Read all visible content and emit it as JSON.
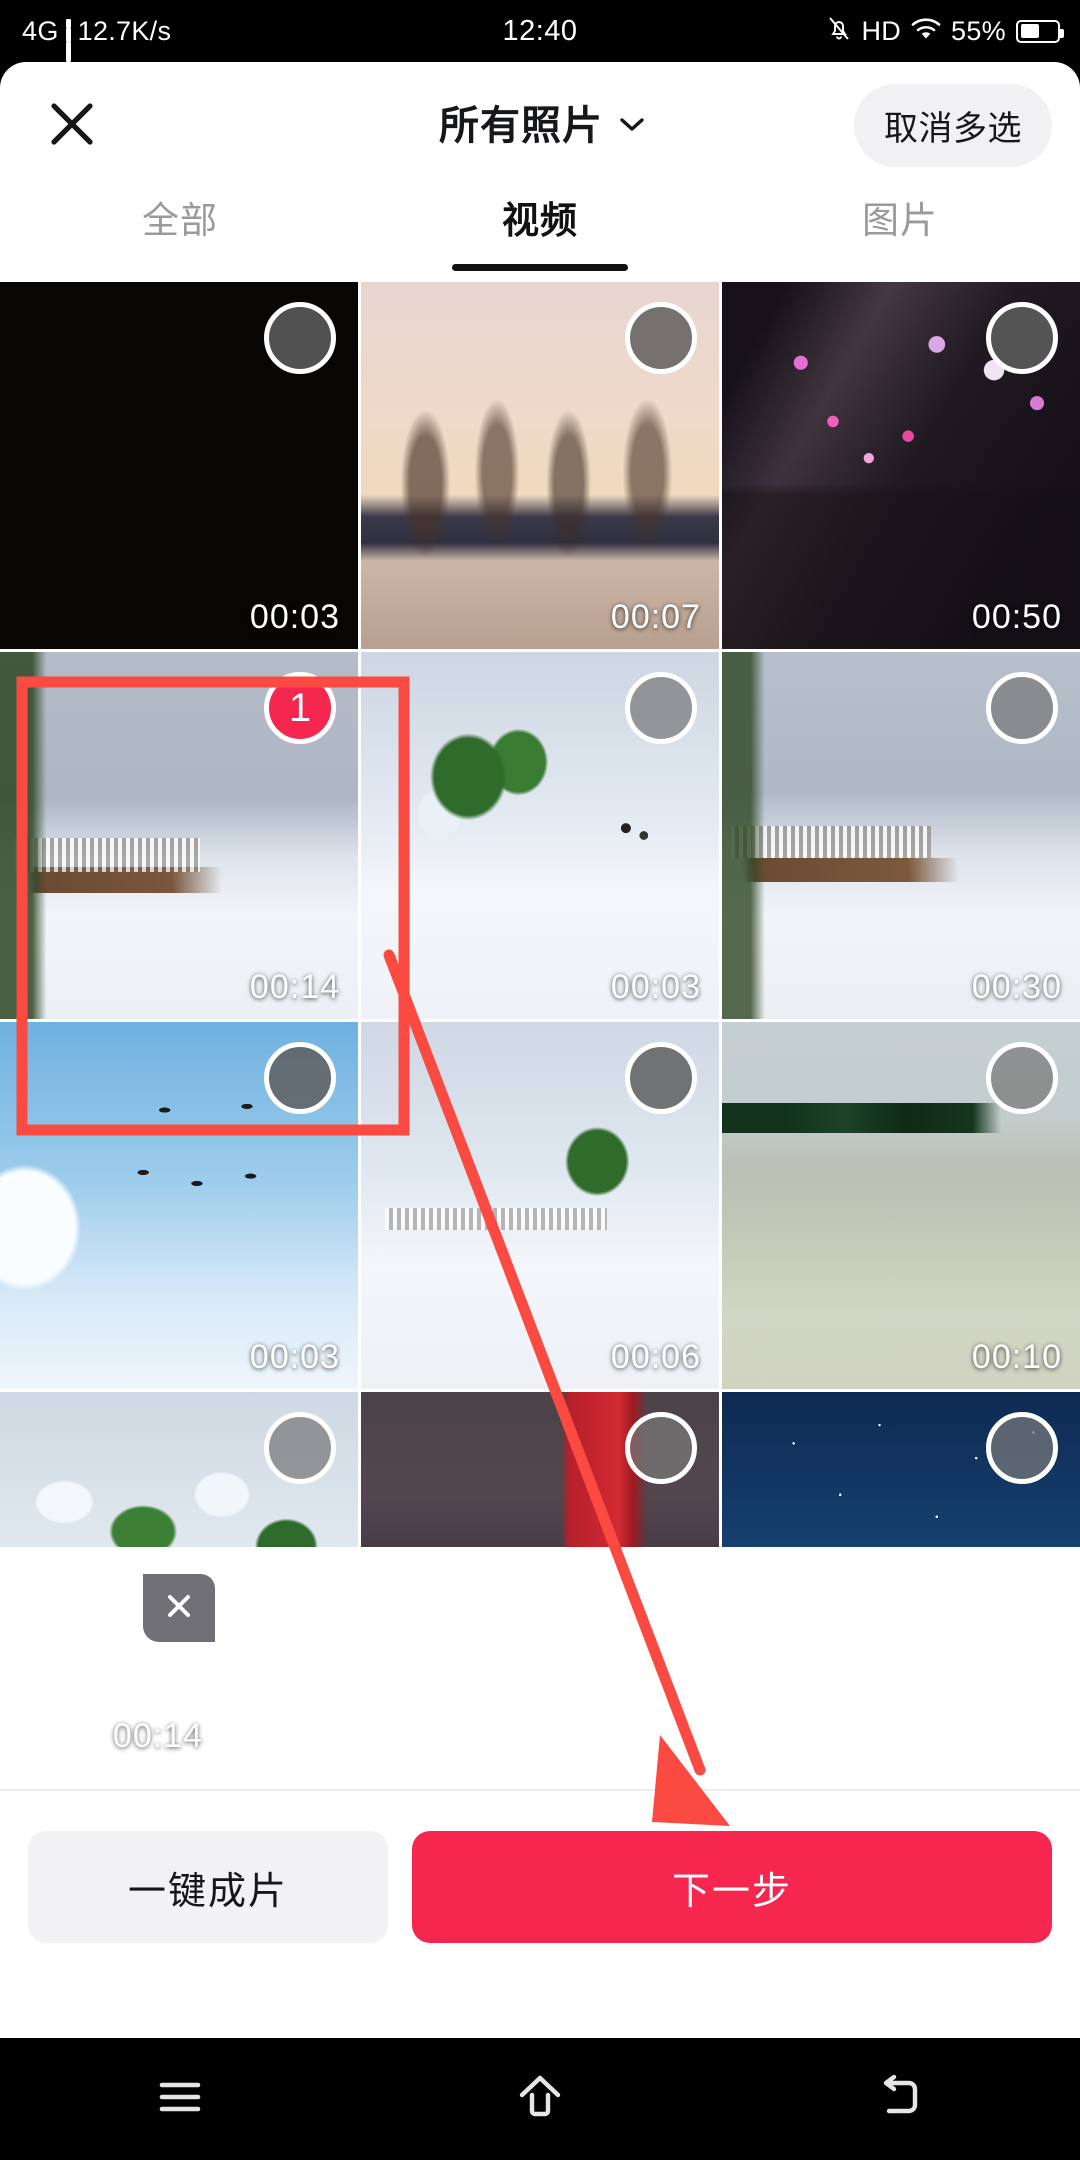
{
  "status_bar": {
    "network_type": "4G",
    "signal_icon": "signal-bars-icon",
    "data_rate": "12.7K/s",
    "time": "12:40",
    "mute_icon": "bell-mute-icon",
    "hd_label": "HD",
    "wifi_icon": "wifi-icon",
    "battery_percent": "55%",
    "battery_icon": "battery-icon"
  },
  "header": {
    "close_icon": "close-icon",
    "album_title": "所有照片",
    "album_chevron_icon": "chevron-down-icon",
    "multi_select_label": "取消多选"
  },
  "tabs": [
    {
      "label": "全部",
      "active": false
    },
    {
      "label": "视频",
      "active": true
    },
    {
      "label": "图片",
      "active": false
    }
  ],
  "grid": {
    "items": [
      {
        "duration": "00:03",
        "selected": false,
        "art": "t-black",
        "circle": "dark"
      },
      {
        "duration": "00:07",
        "selected": false,
        "art": "t-trees-pink",
        "circle": "dark"
      },
      {
        "duration": "00:50",
        "selected": false,
        "art": "t-blossom",
        "circle": "dark"
      },
      {
        "duration": "00:14",
        "selected": true,
        "art": "t-snow-fence",
        "circle": "selected",
        "badge": "1"
      },
      {
        "duration": "00:03",
        "selected": false,
        "art": "t-snow-tree",
        "circle": "light"
      },
      {
        "duration": "00:30",
        "selected": false,
        "art": "t-snow-fence2",
        "circle": "light"
      },
      {
        "duration": "00:03",
        "selected": false,
        "art": "t-birds",
        "circle": "dark"
      },
      {
        "duration": "00:06",
        "selected": false,
        "art": "t-snow-field",
        "circle": "dark"
      },
      {
        "duration": "00:10",
        "selected": false,
        "art": "t-lake",
        "circle": "light"
      },
      {
        "duration": "",
        "selected": false,
        "art": "t-snow-green",
        "circle": "light"
      },
      {
        "duration": "",
        "selected": false,
        "art": "t-festival",
        "circle": "light"
      },
      {
        "duration": "",
        "selected": false,
        "art": "t-night-tree",
        "circle": "light"
      }
    ]
  },
  "tray": {
    "items": [
      {
        "duration": "00:14",
        "remove_icon": "close-icon",
        "art": "t-snow-fence"
      }
    ]
  },
  "actions": {
    "secondary_label": "一键成片",
    "primary_label": "下一步"
  },
  "nav_bar": {
    "recents_icon": "recents-icon",
    "home_icon": "home-icon",
    "back_icon": "back-icon"
  },
  "annotation": {
    "box_color": "#fa4a42",
    "arrow_color": "#fa4a42"
  },
  "colors": {
    "accent_red": "#f5274e",
    "annotation_red": "#fa4a42",
    "tab_active": "#111111",
    "tab_inactive": "#9a9a9e"
  }
}
